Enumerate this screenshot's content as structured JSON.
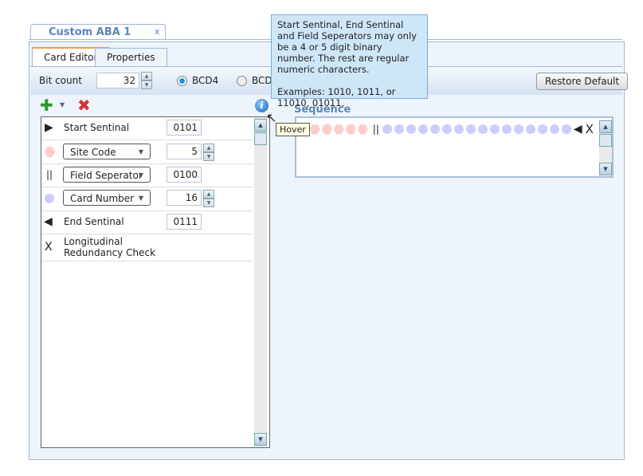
{
  "document_tab": {
    "title": "Custom ABA 1",
    "close": "x"
  },
  "tabs": [
    {
      "label": "Card Editor",
      "active": true
    },
    {
      "label": "Properties",
      "active": false
    }
  ],
  "toolbar": {
    "bit_count_label": "Bit count",
    "bit_count_value": "32",
    "radio_bcd4": "BCD4",
    "radio_bcd5": "BCD",
    "selected": "BCD4",
    "restore_label": "Restore Default"
  },
  "list": {
    "rows": [
      {
        "icon": "triangle-right-icon",
        "label": "Start Sentinal",
        "value": "0101",
        "type": "text"
      },
      {
        "icon": "hexagon-icon",
        "label": "Site Code",
        "value": "5",
        "type": "combo"
      },
      {
        "icon": "double-bar-icon",
        "glyph": "||",
        "label": "Field Seperator",
        "value": "0100",
        "type": "combo"
      },
      {
        "icon": "circle-icon",
        "label": "Card Number",
        "value": "16",
        "type": "combo"
      },
      {
        "icon": "triangle-left-icon",
        "label": "End Sentinal",
        "value": "0111",
        "type": "text"
      },
      {
        "icon": "x-icon",
        "glyph": "X",
        "label": "Longitudinal Redundancy Check",
        "value": "",
        "type": "none"
      }
    ]
  },
  "sequence": {
    "label": "Sequence",
    "separator": "||",
    "end": "X",
    "site_code_count": 5,
    "card_number_count": 16
  },
  "tooltip": {
    "text1": "Start Sentinal, End Sentinal and Field Seperators may only be a 4 or 5 digit binary number. The rest are regular numeric characters.",
    "text2": "Examples: 1010, 1011, or 11010, 01011,"
  },
  "hover_tip": "Hover",
  "colors": {
    "site_code": "#ffcccc",
    "card_number": "#ccccff",
    "accent": "#5a85b8"
  }
}
